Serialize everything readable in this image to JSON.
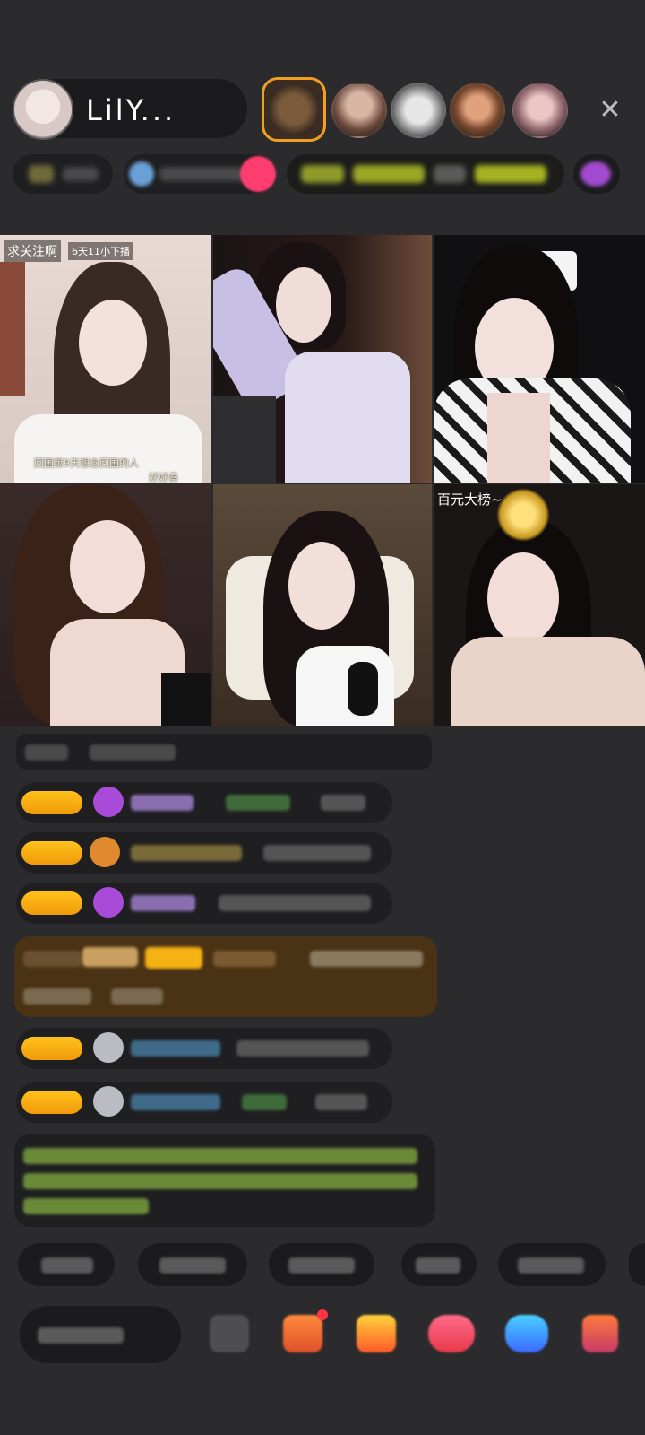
{
  "host": {
    "name": "LilY...",
    "avatar_icon": "host-avatar-icon"
  },
  "header": {
    "close_icon": "close-icon",
    "close_glyph": "✕",
    "viewers": [
      "viewer-1",
      "viewer-2",
      "viewer-3",
      "viewer-4",
      "viewer-5"
    ]
  },
  "grid": {
    "tiles": [
      {
        "tag_left": "求关注啊",
        "tag_right": "6天11小下播",
        "caption": "回国第9天想念回国的人",
        "caption2": "好好奏"
      },
      {
        "tag_left": "",
        "tag_right": "",
        "caption": "",
        "caption2": ""
      },
      {
        "tag_left": "",
        "tag_right": "",
        "caption": "",
        "caption2": ""
      },
      {
        "tag_left": "",
        "tag_right": "",
        "caption": "",
        "caption2": ""
      },
      {
        "tag_left": "",
        "tag_right": "",
        "caption": "",
        "caption2": ""
      },
      {
        "tag_left": "百元大榜~",
        "tag_right": "",
        "caption": "",
        "caption2": ""
      }
    ]
  },
  "colors": {
    "background": "#2b2b2d",
    "panel": "#1f1f21",
    "badge": "#f5b215",
    "gift_banner": "#4a3214",
    "notice_text": "#9ccf5b",
    "accent_pink": "#ff3d6e"
  },
  "bottom_icons": [
    "emoji-icon",
    "gift-box-icon",
    "fan-club-icon",
    "heart-icon",
    "share-icon",
    "more-icon"
  ]
}
